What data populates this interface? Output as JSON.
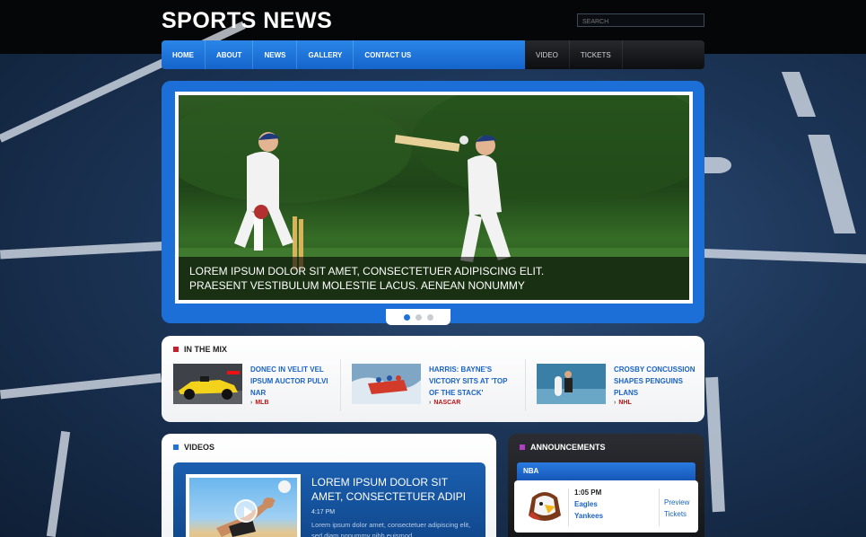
{
  "header": {
    "logo": "SPORTS NEWS",
    "search_placeholder": "SEARCH"
  },
  "nav": {
    "main": [
      "HOME",
      "ABOUT",
      "NEWS",
      "GALLERY",
      "CONTACT US"
    ],
    "side": [
      "VIDEO",
      "TICKETS"
    ]
  },
  "slider": {
    "caption_line1": "LOREM IPSUM DOLOR SIT AMET, CONSECTETUER ADIPISCING ELIT.",
    "caption_line2": "PRAESENT VESTIBULUM MOLESTIE LACUS. AENEAN NONUMMY",
    "active_slide": 1,
    "slide_count": 3
  },
  "mix": {
    "title": "IN THE MIX",
    "accent": "#c8202a",
    "items": [
      {
        "text": "DONEC IN VELIT VEL IPSUM AUCTOR PULVI NAR",
        "tag": "MLB"
      },
      {
        "text": "HARRIS: BAYNE'S VICTORY SITS AT 'TOP OF THE STACK'",
        "tag": "NASCAR"
      },
      {
        "text": "CROSBY CONCUSSION SHAPES PENGUINS PLANS",
        "tag": "NHL"
      }
    ]
  },
  "videos": {
    "title": "VIDEOS",
    "accent": "#1f73d8",
    "card": {
      "title": "LOREM IPSUM DOLOR SIT AMET, CONSECTETUER ADIPI",
      "time": "4:17 PM",
      "desc": "Lorem ipsum dolor amet, consectetuer adipiscing elit, sed diam nonummy nibh euismod"
    }
  },
  "announcements": {
    "title": "ANNOUNCEMENTS",
    "accent": "#b23ec4",
    "league": "NBA",
    "game": {
      "time": "1:05 PM",
      "team1": "Eagles",
      "team2": "Yankees",
      "link1": "Preview",
      "link2": "Tickets"
    }
  }
}
